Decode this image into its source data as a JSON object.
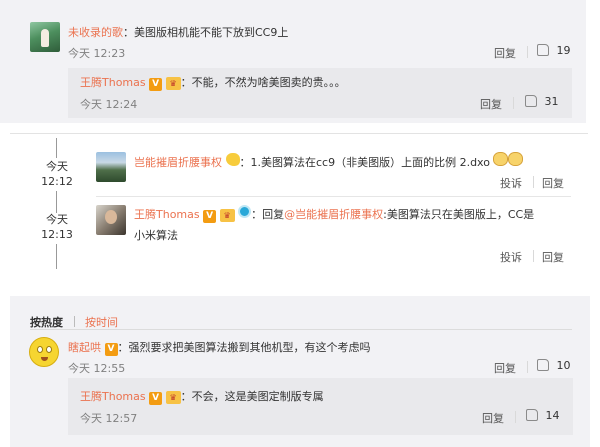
{
  "comment1": {
    "user": "未收录的歌",
    "text": "：美图版相机能不能下放到CC9上",
    "time": "今天 12:23",
    "reply_label": "回复",
    "likes": "19",
    "reply": {
      "user": "王腾Thomas",
      "badge_v": "V",
      "text": "：不能，不然为啥美图卖的贵。。。",
      "time": "今天 12:24",
      "reply_label": "回复",
      "likes": "31"
    }
  },
  "thread2": {
    "post1": {
      "time_day": "今天",
      "time_clock": "12:12",
      "user": "岂能摧眉折腰事权",
      "text": "：1.美图算法在cc9（非美图版）上面的比例 2.dxo",
      "report_label": "投诉",
      "reply_label": "回复"
    },
    "post2": {
      "time_day": "今天",
      "time_clock": "12:13",
      "user": "王腾Thomas",
      "badge_v": "V",
      "text_prefix": "：回复",
      "mention": "@岂能摧眉折腰事权",
      "text_suffix": ":美图算法只在美图版上，CC是",
      "text_line2": "小米算法",
      "report_label": "投诉",
      "reply_label": "回复"
    }
  },
  "section3": {
    "sort_hot": "按热度",
    "sort_time": "按时间",
    "comment": {
      "user": "瞎起哄",
      "badge_v": "V",
      "text": "：强烈要求把美图算法搬到其他机型，有这个考虑吗",
      "time": "今天 12:55",
      "reply_label": "回复",
      "likes": "10",
      "reply": {
        "user": "王腾Thomas",
        "badge_v": "V",
        "text": "：不会，这是美图定制版专属",
        "time": "今天 12:57",
        "reply_label": "回复",
        "likes": "14"
      }
    }
  },
  "colors": {
    "username": "#eb7350",
    "panel_bg": "#f2f2f5",
    "reply_bg": "#e9e9ec",
    "mention": "#eb7350"
  }
}
